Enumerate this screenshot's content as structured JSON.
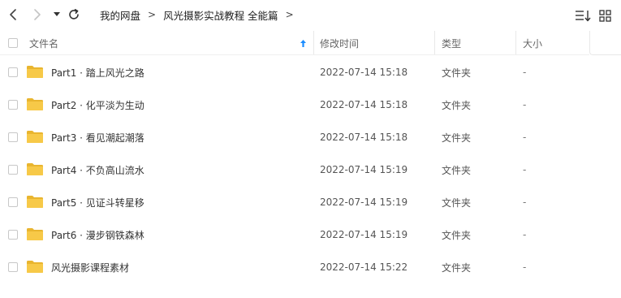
{
  "toolbar": {
    "back_icon": "chevron-left-icon",
    "forward_icon": "chevron-right-icon",
    "history_icon": "caret-down-icon",
    "refresh_icon": "refresh-icon",
    "sort_icon": "sort-list-icon",
    "view_icon": "grid-view-icon"
  },
  "breadcrumb": {
    "items": [
      "我的网盘",
      "风光摄影实战教程 全能篇"
    ],
    "separator": ">"
  },
  "header": {
    "name": "文件名",
    "modified": "修改时间",
    "type": "类型",
    "size": "大小",
    "sort_icon": "sort-ascending-arrow-icon"
  },
  "colors": {
    "accent": "#1a8cff",
    "folder": "#f7c948",
    "folder_dark": "#e9b52f"
  },
  "files": [
    {
      "name": "Part1 · 踏上风光之路",
      "modified": "2022-07-14 15:18",
      "type": "文件夹",
      "size": "-"
    },
    {
      "name": "Part2 · 化平淡为生动",
      "modified": "2022-07-14 15:18",
      "type": "文件夹",
      "size": "-"
    },
    {
      "name": "Part3 · 看见潮起潮落",
      "modified": "2022-07-14 15:18",
      "type": "文件夹",
      "size": "-"
    },
    {
      "name": "Part4 · 不负高山流水",
      "modified": "2022-07-14 15:19",
      "type": "文件夹",
      "size": "-"
    },
    {
      "name": "Part5 · 见证斗转星移",
      "modified": "2022-07-14 15:19",
      "type": "文件夹",
      "size": "-"
    },
    {
      "name": "Part6 · 漫步钢铁森林",
      "modified": "2022-07-14 15:19",
      "type": "文件夹",
      "size": "-"
    },
    {
      "name": "风光摄影课程素材",
      "modified": "2022-07-14 15:22",
      "type": "文件夹",
      "size": "-"
    }
  ]
}
